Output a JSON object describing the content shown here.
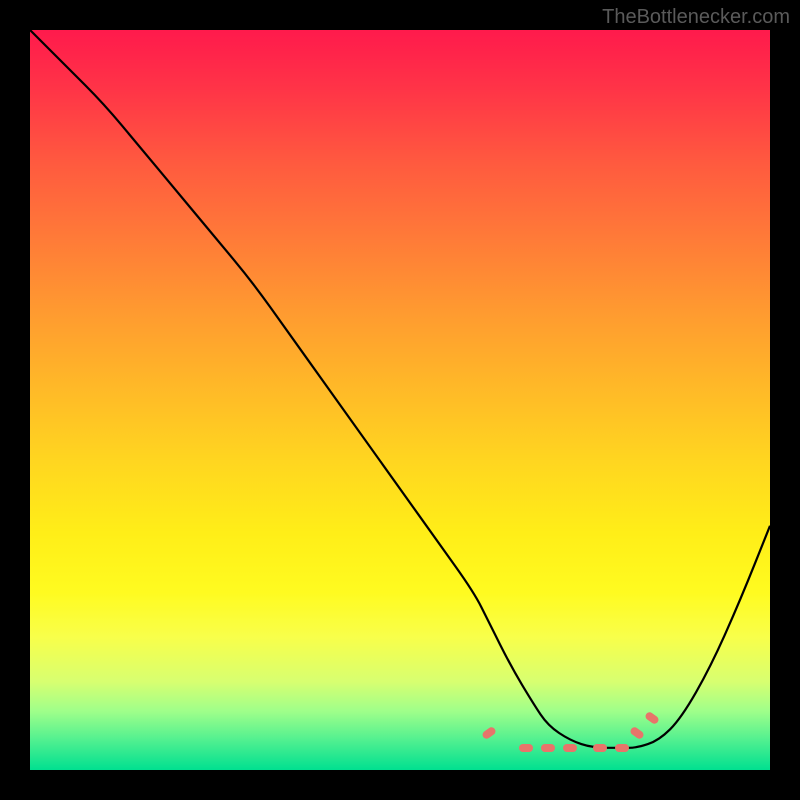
{
  "watermark": "TheBottlenecker.com",
  "chart_data": {
    "type": "line",
    "title": "",
    "xlabel": "",
    "ylabel": "",
    "xlim": [
      0,
      100
    ],
    "ylim": [
      0,
      100
    ],
    "background_gradient": {
      "top": "#ff1a4c",
      "middle": "#ffee18",
      "bottom": "#00e090"
    },
    "series": [
      {
        "name": "bottleneck-curve",
        "x": [
          0,
          5,
          10,
          15,
          20,
          25,
          30,
          35,
          40,
          45,
          50,
          55,
          60,
          62,
          65,
          68,
          70,
          73,
          76,
          80,
          82,
          85,
          88,
          92,
          96,
          100
        ],
        "values": [
          100,
          95,
          90,
          84,
          78,
          72,
          66,
          59,
          52,
          45,
          38,
          31,
          24,
          20,
          14,
          9,
          6,
          4,
          3,
          3,
          3,
          4,
          7,
          14,
          23,
          33
        ]
      }
    ],
    "markers": {
      "name": "highlighted-region",
      "points": [
        {
          "x": 62,
          "y": 5
        },
        {
          "x": 67,
          "y": 3
        },
        {
          "x": 70,
          "y": 3
        },
        {
          "x": 73,
          "y": 3
        },
        {
          "x": 77,
          "y": 3
        },
        {
          "x": 80,
          "y": 3
        },
        {
          "x": 82,
          "y": 5
        },
        {
          "x": 84,
          "y": 7
        }
      ],
      "color": "#e8746a"
    }
  }
}
